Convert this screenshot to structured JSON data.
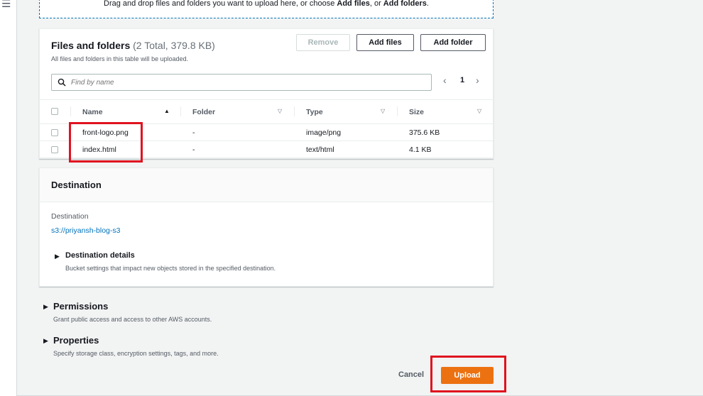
{
  "nav": {
    "menu_icon": "☰"
  },
  "dropzone": {
    "text_prefix": "Drag and drop files and folders you want to upload here, or choose ",
    "add_files": "Add files",
    "text_middle": ", or ",
    "add_folders": "Add folders",
    "text_suffix": "."
  },
  "files_panel": {
    "title": "Files and folders",
    "count": "(2 Total, 379.8 KB)",
    "subtitle": "All files and folders in this table will be uploaded.",
    "remove_label": "Remove",
    "add_files_label": "Add files",
    "add_folder_label": "Add folder",
    "search_placeholder": "Find by name",
    "pager": {
      "prev": "‹",
      "page": "1",
      "next": "›"
    },
    "columns": [
      "Name",
      "Folder",
      "Type",
      "Size"
    ],
    "rows": [
      {
        "name": "front-logo.png",
        "folder": "-",
        "type": "image/png",
        "size": "375.6 KB"
      },
      {
        "name": "index.html",
        "folder": "-",
        "type": "text/html",
        "size": "4.1 KB"
      }
    ]
  },
  "destination": {
    "title": "Destination",
    "label": "Destination",
    "link": "s3://priyansh-blog-s3",
    "details_title": "Destination details",
    "details_sub": "Bucket settings that impact new objects stored in the specified destination."
  },
  "permissions": {
    "title": "Permissions",
    "sub": "Grant public access and access to other AWS accounts."
  },
  "properties": {
    "title": "Properties",
    "sub": "Specify storage class, encryption settings, tags, and more."
  },
  "footer": {
    "cancel_label": "Cancel",
    "upload_label": "Upload"
  },
  "colors": {
    "accent": "#ec7211",
    "link": "#0073bb",
    "highlight": "#e0131f"
  }
}
